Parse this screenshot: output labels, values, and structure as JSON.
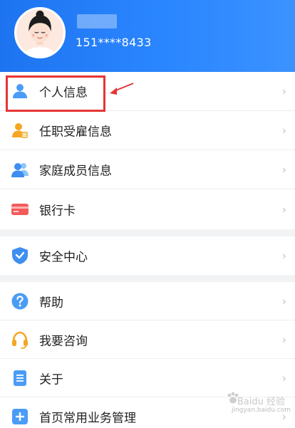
{
  "user": {
    "phone": "151****8433"
  },
  "menu_group_1": [
    {
      "label": "个人信息",
      "icon": "person-icon"
    },
    {
      "label": "任职受雇信息",
      "icon": "employee-icon"
    },
    {
      "label": "家庭成员信息",
      "icon": "family-icon"
    },
    {
      "label": "银行卡",
      "icon": "bank-card-icon"
    }
  ],
  "menu_group_2": [
    {
      "label": "安全中心",
      "icon": "shield-icon"
    }
  ],
  "menu_group_3": [
    {
      "label": "帮助",
      "icon": "help-icon"
    },
    {
      "label": "我要咨询",
      "icon": "headset-icon"
    },
    {
      "label": "关于",
      "icon": "document-icon"
    },
    {
      "label": "首页常用业务管理",
      "icon": "plus-icon"
    }
  ],
  "chevron": "›",
  "watermark": {
    "main": "Baidu 经验",
    "sub": "jingyan.baidu.com"
  },
  "colors": {
    "header_blue": "#2a86ff",
    "highlight_red": "#e53535",
    "accent_orange": "#f5a623"
  }
}
